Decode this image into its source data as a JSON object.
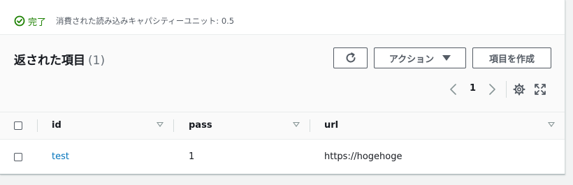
{
  "status": {
    "state_label": "完了",
    "capacity_text": "消費された読み込みキャパシティーユニット: 0.5",
    "success_color": "#1d8102"
  },
  "header": {
    "title": "返された項目",
    "count": "(1)",
    "refresh_icon": "refresh-icon",
    "actions_label": "アクション",
    "create_label": "項目を作成"
  },
  "pagination": {
    "current_page": "1",
    "prev_icon": "chevron-left-icon",
    "next_icon": "chevron-right-icon",
    "settings_icon": "gear-icon",
    "fullscreen_icon": "fullscreen-icon"
  },
  "table": {
    "columns": [
      {
        "label": "id"
      },
      {
        "label": "pass"
      },
      {
        "label": "url"
      }
    ],
    "rows": [
      {
        "id": "test",
        "pass": "1",
        "url": "https://hogehoge"
      }
    ],
    "link_color": "#0073bb"
  }
}
